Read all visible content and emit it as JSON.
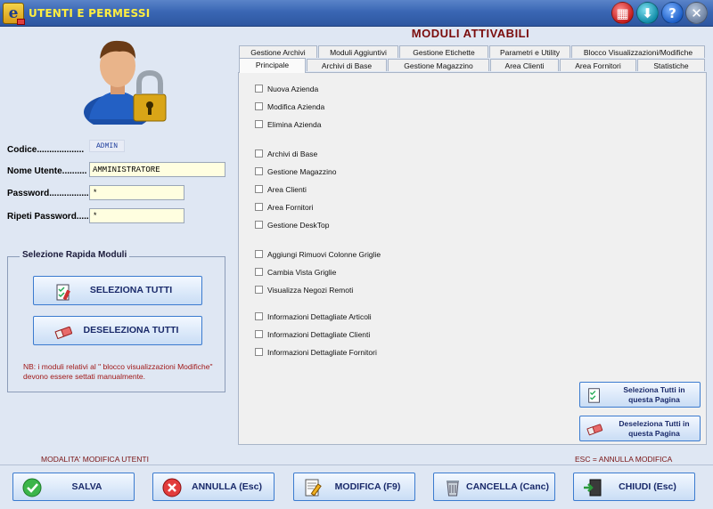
{
  "window": {
    "title": "UTENTI E PERMESSI",
    "app_icon_letter": "e"
  },
  "titlebar_buttons": [
    {
      "name": "calculator-icon",
      "glyph": "▦"
    },
    {
      "name": "download-icon",
      "glyph": "⬇"
    },
    {
      "name": "help-icon",
      "glyph": "?"
    },
    {
      "name": "close-icon",
      "glyph": "✕"
    }
  ],
  "user_form": {
    "code_label": "Codice...................",
    "code_value": "ADMIN",
    "username_label": "Nome Utente..........",
    "username_value": "AMMINISTRATORE",
    "password_label": "Password................",
    "password_value": "*",
    "repeat_password_label": "Ripeti Password......",
    "repeat_password_value": "*"
  },
  "quick_select": {
    "title": "Selezione Rapida Moduli",
    "select_all": "SELEZIONA TUTTI",
    "deselect_all": "DESELEZIONA TUTTI",
    "note": "NB: i moduli relativi al \" blocco visualizzazioni Modifiche\" devono essere  settati manualmente."
  },
  "modules": {
    "title": "MODULI ATTIVABILI",
    "tabs_row1": [
      "Gestione Archivi",
      "Moduli Aggiuntivi",
      "Gestione Etichette",
      "Parametri e Utility",
      "Blocco Visualizzazioni/Modifiche"
    ],
    "tabs_row2": [
      "Principale",
      "Archivi di Base",
      "Gestione Magazzino",
      "Area Clienti",
      "Area Fornitori",
      "Statistiche"
    ],
    "active_tab": "Principale",
    "checkboxes": [
      "Nuova Azienda",
      "Modifica Azienda",
      "Elimina Azienda",
      "Archivi di Base",
      "Gestione Magazzino",
      "Area Clienti",
      "Area Fornitori",
      "Gestione DeskTop",
      "Aggiungi Rimuovi Colonne Griglie",
      "Cambia Vista Griglie",
      "Visualizza Negozi Remoti",
      "Informazioni Dettagliate Articoli",
      "Informazioni Dettagliate Clienti",
      "Informazioni Dettagliate Fornitori"
    ],
    "select_page": "Seleziona Tutti in questa Pagina",
    "deselect_page": "Deseleziona Tutti in questa Pagina"
  },
  "status": {
    "mode": "MODALITA' MODIFICA UTENTI",
    "esc_hint": "ESC = ANNULLA MODIFICA"
  },
  "actions": {
    "save": "SALVA",
    "cancel": "ANNULLA (Esc)",
    "edit": "MODIFICA  (F9)",
    "delete": "CANCELLA  (Canc)",
    "close": "CHIUDI  (Esc)"
  }
}
